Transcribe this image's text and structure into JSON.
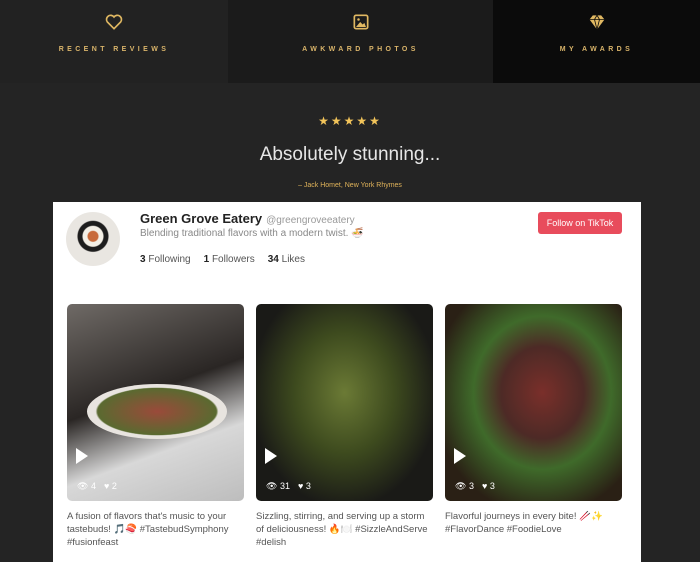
{
  "nav": [
    {
      "label": "RECENT REVIEWS",
      "icon": "heart-icon"
    },
    {
      "label": "AWKWARD PHOTOS",
      "icon": "image-icon"
    },
    {
      "label": "MY AWARDS",
      "icon": "diamond-icon"
    }
  ],
  "review": {
    "stars": "★★★★★",
    "rating": 5,
    "quote": "Absolutely stunning...",
    "author": "– Jack Homet, New York Rhymes"
  },
  "profile": {
    "name": "Green Grove Eatery",
    "handle": "@greengroveeatery",
    "bio": "Blending traditional flavors with a modern twist. 🍜",
    "following": "3",
    "following_label": "Following",
    "followers": "1",
    "followers_label": "Followers",
    "likes": "34",
    "likes_label": "Likes",
    "follow_button": "Follow on TikTok"
  },
  "posts": [
    {
      "views": "4",
      "likes": "2",
      "caption": "A fusion of flavors that's music to your tastebuds! 🎵🍣 #TastebudSymphony #fusionfeast"
    },
    {
      "views": "31",
      "likes": "3",
      "caption": "Sizzling, stirring, and serving up a storm of deliciousness! 🔥🍽️ #SizzleAndServe #delish"
    },
    {
      "views": "3",
      "likes": "3",
      "caption": "Flavorful journeys in every bite! 🥢✨ #FlavorDance #FoodieLove"
    }
  ],
  "colors": {
    "accent": "#d9b46a",
    "follow": "#e84c5c"
  }
}
